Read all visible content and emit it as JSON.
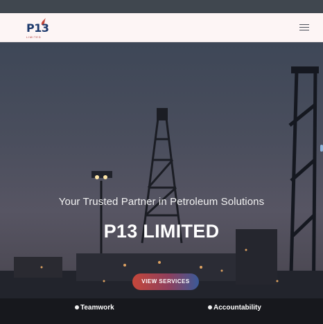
{
  "brand": {
    "logo_text": "P13",
    "logo_subtext": "LIMITED"
  },
  "nav": {
    "menu_icon": "hamburger-icon"
  },
  "hero": {
    "tagline": "Your Trusted Partner in Petroleum Solutions",
    "title": "P13 LIMITED",
    "cta_label": "VIEW SERVICES",
    "values": [
      "Teamwork",
      "Accountability"
    ]
  },
  "colors": {
    "brand_navy": "#1d3a6d",
    "brand_red": "#c5473a",
    "nav_background": "#fdf5f5",
    "cta_gradient_start": "#c5473a",
    "cta_gradient_end": "#3a5a98"
  }
}
